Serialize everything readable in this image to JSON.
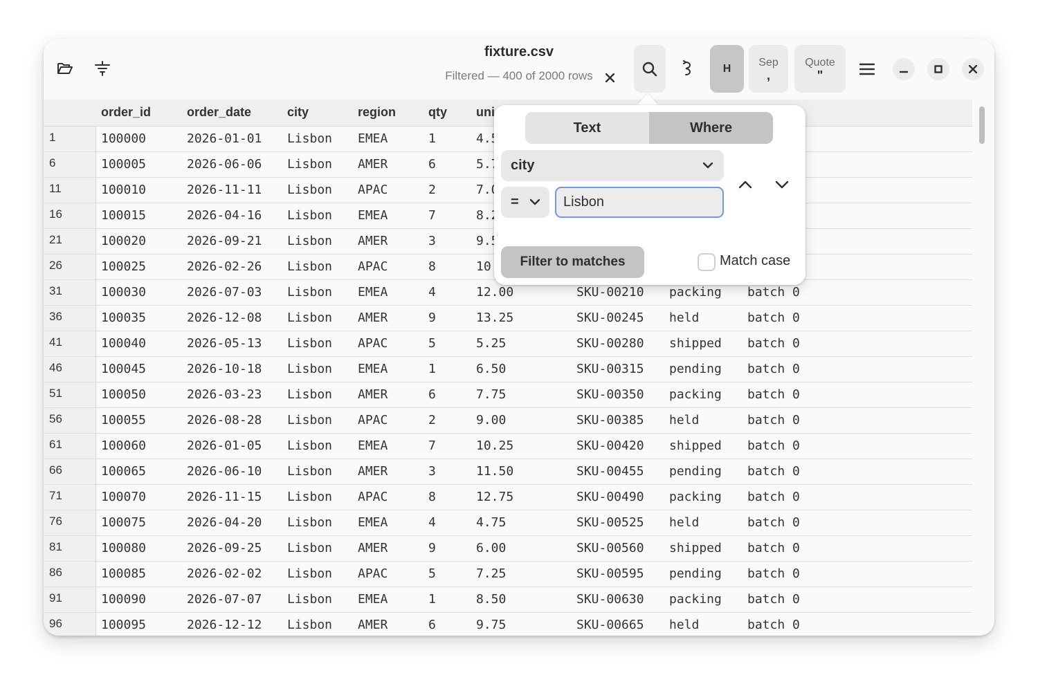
{
  "header": {
    "title": "fixture.csv",
    "subtitle": "Filtered — 400 of 2000 rows",
    "header_toggle_label": "H",
    "sep_label": "Sep",
    "sep_value": ",",
    "quote_label": "Quote",
    "quote_value": "\""
  },
  "table": {
    "columns": [
      "order_id",
      "order_date",
      "city",
      "region",
      "qty",
      "uni"
    ],
    "rows": [
      {
        "n": "1",
        "c": [
          "100000",
          "2026-01-01",
          "Lisbon",
          "EMEA",
          "1",
          "4.5"
        ]
      },
      {
        "n": "6",
        "c": [
          "100005",
          "2026-06-06",
          "Lisbon",
          "AMER",
          "6",
          "5.7"
        ]
      },
      {
        "n": "11",
        "c": [
          "100010",
          "2026-11-11",
          "Lisbon",
          "APAC",
          "2",
          "7.0"
        ]
      },
      {
        "n": "16",
        "c": [
          "100015",
          "2026-04-16",
          "Lisbon",
          "EMEA",
          "7",
          "8.2"
        ]
      },
      {
        "n": "21",
        "c": [
          "100020",
          "2026-09-21",
          "Lisbon",
          "AMER",
          "3",
          "9.5"
        ]
      },
      {
        "n": "26",
        "c": [
          "100025",
          "2026-02-26",
          "Lisbon",
          "APAC",
          "8",
          "10"
        ]
      },
      {
        "n": "31",
        "c": [
          "100030",
          "2026-07-03",
          "Lisbon",
          "EMEA",
          "4",
          "12.00",
          "SKU-00210",
          "packing",
          "batch 0"
        ]
      },
      {
        "n": "36",
        "c": [
          "100035",
          "2026-12-08",
          "Lisbon",
          "AMER",
          "9",
          "13.25",
          "SKU-00245",
          "held",
          "batch 0"
        ]
      },
      {
        "n": "41",
        "c": [
          "100040",
          "2026-05-13",
          "Lisbon",
          "APAC",
          "5",
          "5.25",
          "SKU-00280",
          "shipped",
          "batch 0"
        ]
      },
      {
        "n": "46",
        "c": [
          "100045",
          "2026-10-18",
          "Lisbon",
          "EMEA",
          "1",
          "6.50",
          "SKU-00315",
          "pending",
          "batch 0"
        ]
      },
      {
        "n": "51",
        "c": [
          "100050",
          "2026-03-23",
          "Lisbon",
          "AMER",
          "6",
          "7.75",
          "SKU-00350",
          "packing",
          "batch 0"
        ]
      },
      {
        "n": "56",
        "c": [
          "100055",
          "2026-08-28",
          "Lisbon",
          "APAC",
          "2",
          "9.00",
          "SKU-00385",
          "held",
          "batch 0"
        ]
      },
      {
        "n": "61",
        "c": [
          "100060",
          "2026-01-05",
          "Lisbon",
          "EMEA",
          "7",
          "10.25",
          "SKU-00420",
          "shipped",
          "batch 0"
        ]
      },
      {
        "n": "66",
        "c": [
          "100065",
          "2026-06-10",
          "Lisbon",
          "AMER",
          "3",
          "11.50",
          "SKU-00455",
          "pending",
          "batch 0"
        ]
      },
      {
        "n": "71",
        "c": [
          "100070",
          "2026-11-15",
          "Lisbon",
          "APAC",
          "8",
          "12.75",
          "SKU-00490",
          "packing",
          "batch 0"
        ]
      },
      {
        "n": "76",
        "c": [
          "100075",
          "2026-04-20",
          "Lisbon",
          "EMEA",
          "4",
          "4.75",
          "SKU-00525",
          "held",
          "batch 0"
        ]
      },
      {
        "n": "81",
        "c": [
          "100080",
          "2026-09-25",
          "Lisbon",
          "AMER",
          "9",
          "6.00",
          "SKU-00560",
          "shipped",
          "batch 0"
        ]
      },
      {
        "n": "86",
        "c": [
          "100085",
          "2026-02-02",
          "Lisbon",
          "APAC",
          "5",
          "7.25",
          "SKU-00595",
          "pending",
          "batch 0"
        ]
      },
      {
        "n": "91",
        "c": [
          "100090",
          "2026-07-07",
          "Lisbon",
          "EMEA",
          "1",
          "8.50",
          "SKU-00630",
          "packing",
          "batch 0"
        ]
      },
      {
        "n": "96",
        "c": [
          "100095",
          "2026-12-12",
          "Lisbon",
          "AMER",
          "6",
          "9.75",
          "SKU-00665",
          "held",
          "batch 0"
        ]
      }
    ]
  },
  "search": {
    "tabs": [
      "Text",
      "Where"
    ],
    "active_tab": "Where",
    "column": "city",
    "operator": "=",
    "value": "Lisbon",
    "filter_button": "Filter to matches",
    "match_case_label": "Match case",
    "match_case_checked": false
  }
}
